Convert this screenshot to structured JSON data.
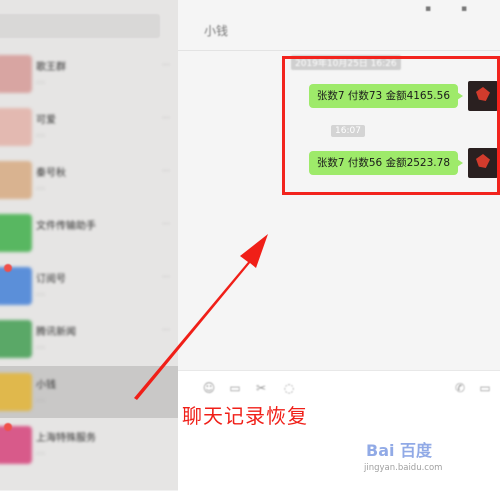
{
  "sidebar": {
    "items": [
      {
        "name": "歌王群",
        "msg": "…",
        "time": "…",
        "avatar_color": "#d8a5a2",
        "badge": false
      },
      {
        "name": "可爱",
        "msg": "…",
        "time": "…",
        "avatar_color": "#e3b9b1",
        "badge": false
      },
      {
        "name": "秦号秋",
        "msg": "…",
        "time": "…",
        "avatar_color": "#d9b390",
        "badge": false
      },
      {
        "name": "文件传输助手",
        "msg": "",
        "time": "…",
        "avatar_color": "#58b761",
        "badge": false
      },
      {
        "name": "订阅号",
        "msg": "…",
        "time": "…",
        "avatar_color": "#5b8fd9",
        "badge": true
      },
      {
        "name": "腾讯新闻",
        "msg": "…",
        "time": "…",
        "avatar_color": "#5aa867",
        "badge": false
      },
      {
        "name": "小钱",
        "msg": "…",
        "time": "",
        "avatar_color": "#e0b84c",
        "badge": false
      },
      {
        "name": "上海特殊服务",
        "msg": "…",
        "time": "",
        "avatar_color": "#d85a8a",
        "badge": true
      }
    ]
  },
  "chat": {
    "title": "小钱",
    "window_controls": [
      "▪",
      "▪"
    ],
    "timestamps": [
      "2019年10月25日 16:26",
      "16:07"
    ],
    "messages": [
      {
        "text": "张数7 付数73 金额4165.56"
      },
      {
        "text": "张数7 付数56 金额2523.78"
      }
    ],
    "bubble_color": "#9eea6a",
    "tools": [
      "☺",
      "▭",
      "✂",
      "◌"
    ],
    "call_icons": [
      "✆",
      "▭"
    ]
  },
  "annotation": {
    "caption": "聊天记录恢复",
    "color": "#f01f18"
  },
  "watermark": {
    "logo": "Bai 百度",
    "url": "jingyan.baidu.com"
  }
}
